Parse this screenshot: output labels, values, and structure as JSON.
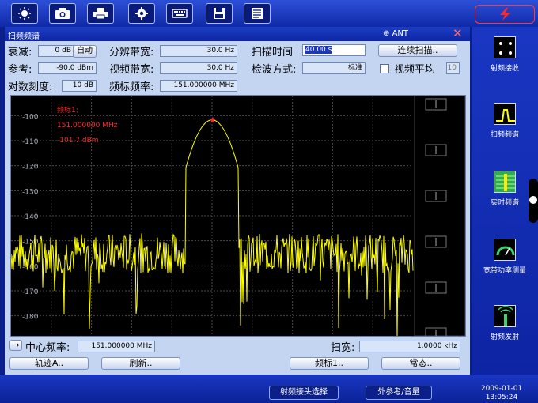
{
  "toolbar": {
    "buttons": [
      {
        "icon": "brightness-icon"
      },
      {
        "icon": "camera-icon"
      },
      {
        "icon": "printer-icon"
      },
      {
        "icon": "settings-gear-icon"
      },
      {
        "icon": "keyboard-icon"
      },
      {
        "icon": "save-disk-icon"
      },
      {
        "icon": "document-icon"
      }
    ],
    "alarm_icon": "lightning-alarm-icon"
  },
  "panel": {
    "title": "扫频频谱",
    "antenna": "ANT",
    "close_glyph": "✕"
  },
  "params": {
    "attenuation_label": "衰减:",
    "attenuation_value": "0 dB",
    "attenuation_auto": "自动",
    "rbw_label": "分辨带宽:",
    "rbw_value": "30.0  Hz",
    "sweep_time_label": "扫描时间",
    "sweep_time_value": "40.00  s",
    "continuous_sweep": "连续扫描..",
    "reference_label": "参考:",
    "reference_value": "-90.0 dBm",
    "vbw_label": "视频带宽:",
    "vbw_value": "30.0  Hz",
    "detector_label": "检波方式:",
    "detector_value": "标准",
    "video_avg_label": "视频平均",
    "video_avg_value": "10",
    "log_scale_label": "对数刻度:",
    "log_scale_value": "10 dB",
    "marker_freq_label": "频标频率:",
    "marker_freq_value": "151.000000 MHz"
  },
  "marker": {
    "title": "频标1:",
    "freq": "151.000000 MHz",
    "level": "-101.7 dBm"
  },
  "chart_data": {
    "type": "line",
    "y_ticks": [
      "-100",
      "-110",
      "-120",
      "-130",
      "-140",
      "-150",
      "-160",
      "-170",
      "-180"
    ],
    "ylim": [
      -188,
      -92
    ],
    "center_freq_mhz": 151.0,
    "span_khz": 1.0,
    "peak": {
      "x_rel": 0.0,
      "y": -101.7
    },
    "noise_floor": -155,
    "series": [
      {
        "color": "#ffff00"
      }
    ]
  },
  "bottom": {
    "center_freq_label": "中心频率:",
    "center_freq_value": "151.000000 MHz",
    "span_label": "扫宽:",
    "span_value": "1.0000 kHz",
    "trace_button": "轨迹A..",
    "refresh_button": "刷新..",
    "marker_button": "频标1..",
    "normal_button": "常态.."
  },
  "statusbar": {
    "rf_select": "射频接头选择",
    "ext_ref": "外参考/音量",
    "date": "2009-01-01",
    "time": "13:05:24"
  },
  "sidebar": {
    "items": [
      {
        "label": "射频接收",
        "icon": "rf-receive-icon"
      },
      {
        "label": "扫频频谱",
        "icon": "sweep-spectrum-icon"
      },
      {
        "label": "实时频谱",
        "icon": "realtime-spectrum-icon"
      },
      {
        "label": "宽带功率测量",
        "icon": "power-meter-icon"
      },
      {
        "label": "射频发射",
        "icon": "rf-transmit-icon"
      }
    ]
  },
  "colors": {
    "trace": "#ffff00",
    "marker_text": "#ff2a2a",
    "background": "#0b1f8a"
  }
}
